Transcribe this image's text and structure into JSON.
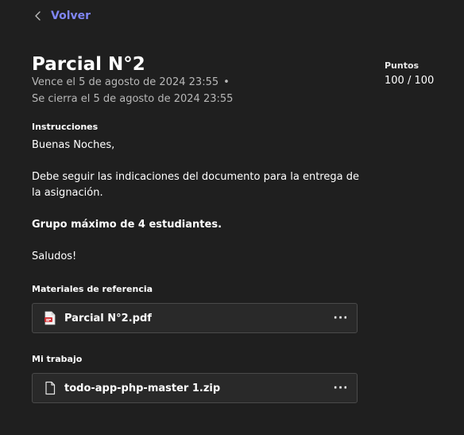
{
  "nav": {
    "back_label": "Volver"
  },
  "assignment": {
    "title": "Parcial N°2",
    "due_line": "Vence el 5 de agosto de 2024 23:55",
    "due_separator": "•",
    "close_line": "Se cierra el 5 de agosto de 2024 23:55"
  },
  "points": {
    "label": "Puntos",
    "value": "100 / 100"
  },
  "instructions": {
    "heading": "Instrucciones",
    "greeting": "Buenas Noches,",
    "body": "Debe seguir las indicaciones del documento para la entrega de la asignación.",
    "emphasis": "Grupo máximo de 4 estudiantes.",
    "closing": "Saludos!"
  },
  "reference_materials": {
    "heading": "Materiales de referencia",
    "files": [
      {
        "name": "Parcial N°2.pdf",
        "icon": "pdf-file-icon",
        "more_label": "···"
      }
    ]
  },
  "my_work": {
    "heading": "Mi trabajo",
    "files": [
      {
        "name": "todo-app-php-master 1.zip",
        "icon": "file-icon",
        "more_label": "···"
      }
    ]
  },
  "colors": {
    "background": "#1f1f1f",
    "accent": "#7f85f5",
    "card_background": "#292929",
    "card_border": "#4a4a4a",
    "secondary_text": "#b8b8b8",
    "pdf_red": "#d13438"
  }
}
